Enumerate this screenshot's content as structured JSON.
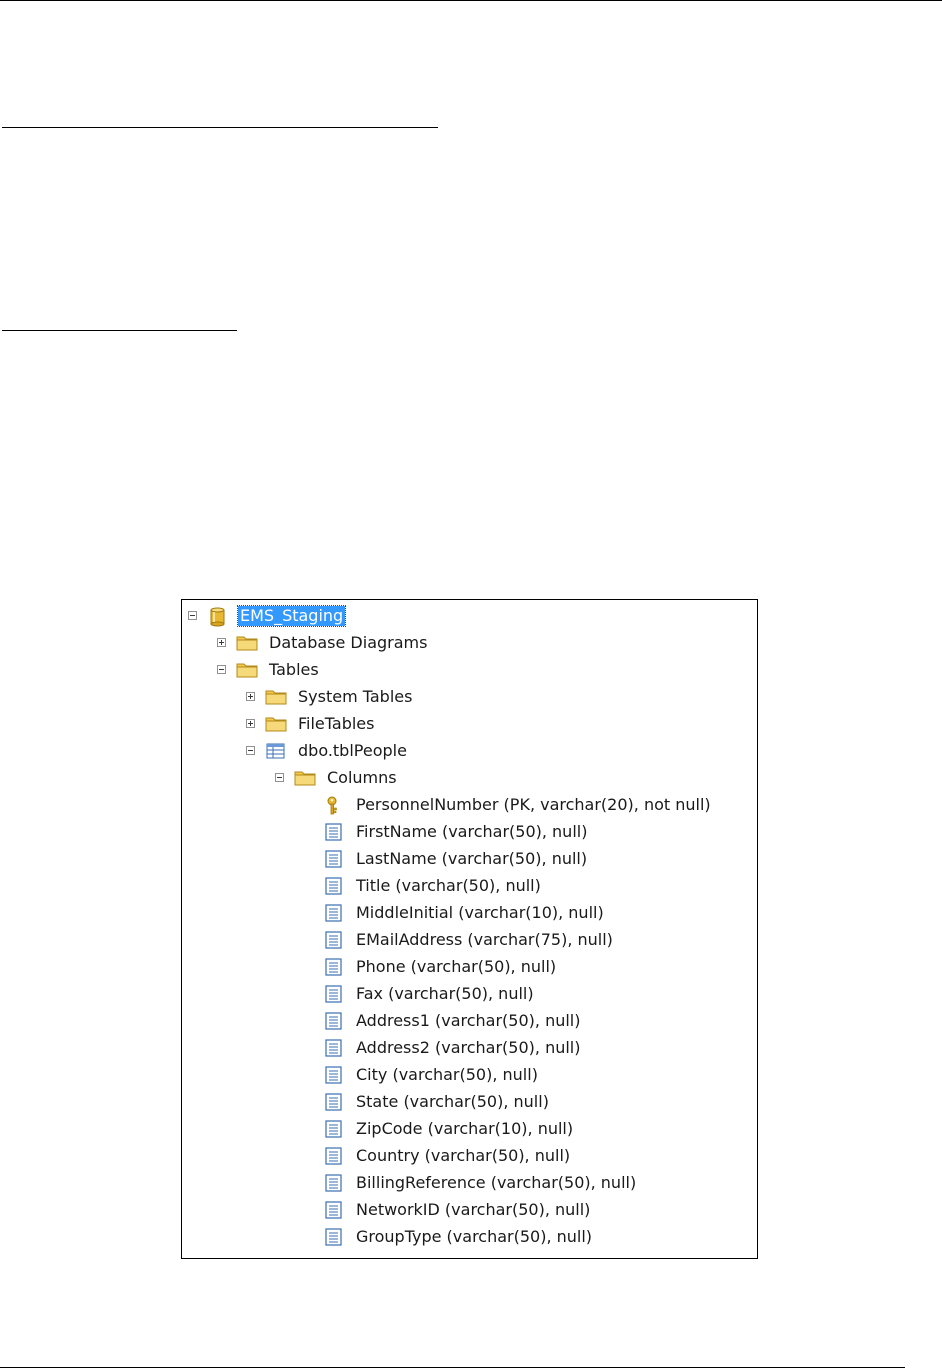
{
  "tree": {
    "root": {
      "label": "EMS_Staging",
      "expanded": true,
      "selected": true
    },
    "database_diagrams": {
      "label": "Database Diagrams",
      "expanded": false
    },
    "tables": {
      "label": "Tables",
      "expanded": true
    },
    "system_tables": {
      "label": "System Tables",
      "expanded": false
    },
    "file_tables": {
      "label": "FileTables",
      "expanded": false
    },
    "table": {
      "label": "dbo.tblPeople",
      "expanded": true
    },
    "columns_folder": {
      "label": "Columns",
      "expanded": true
    },
    "columns": [
      {
        "label": "PersonnelNumber (PK, varchar(20), not null)",
        "icon": "primary-key-icon"
      },
      {
        "label": "FirstName (varchar(50), null)",
        "icon": "column-icon"
      },
      {
        "label": "LastName (varchar(50), null)",
        "icon": "column-icon"
      },
      {
        "label": "Title (varchar(50), null)",
        "icon": "column-icon"
      },
      {
        "label": "MiddleInitial (varchar(10), null)",
        "icon": "column-icon"
      },
      {
        "label": "EMailAddress (varchar(75), null)",
        "icon": "column-icon"
      },
      {
        "label": "Phone (varchar(50), null)",
        "icon": "column-icon"
      },
      {
        "label": "Fax (varchar(50), null)",
        "icon": "column-icon"
      },
      {
        "label": "Address1 (varchar(50), null)",
        "icon": "column-icon"
      },
      {
        "label": "Address2 (varchar(50), null)",
        "icon": "column-icon"
      },
      {
        "label": "City (varchar(50), null)",
        "icon": "column-icon"
      },
      {
        "label": "State (varchar(50), null)",
        "icon": "column-icon"
      },
      {
        "label": "ZipCode (varchar(10), null)",
        "icon": "column-icon"
      },
      {
        "label": "Country (varchar(50), null)",
        "icon": "column-icon"
      },
      {
        "label": "BillingReference (varchar(50), null)",
        "icon": "column-icon"
      },
      {
        "label": "NetworkID (varchar(50), null)",
        "icon": "column-icon"
      },
      {
        "label": "GroupType (varchar(50), null)",
        "icon": "column-icon"
      }
    ]
  },
  "colors": {
    "selection": "#3399ff",
    "folder": "#f2c94c",
    "database": "#e8b830",
    "column_icon": "#3a6fb0"
  }
}
